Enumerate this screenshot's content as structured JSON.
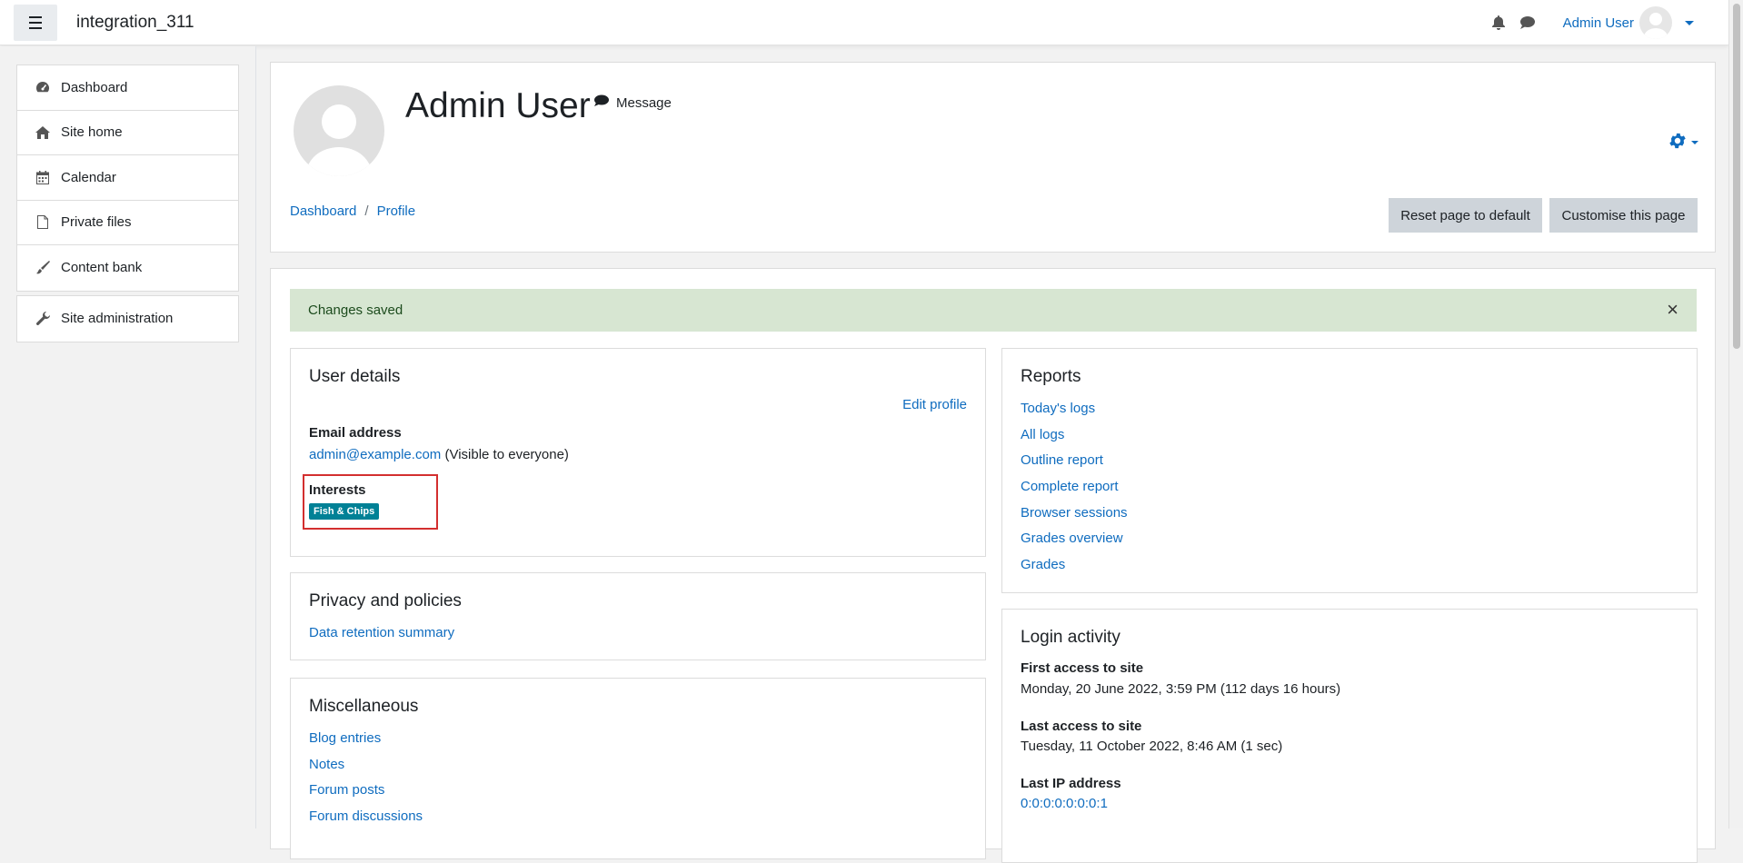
{
  "navbar": {
    "site_name": "integration_311",
    "user_name": "Admin User"
  },
  "sidebar": {
    "items": [
      {
        "label": "Dashboard",
        "icon": "dashboard-icon"
      },
      {
        "label": "Site home",
        "icon": "home-icon"
      },
      {
        "label": "Calendar",
        "icon": "calendar-icon"
      },
      {
        "label": "Private files",
        "icon": "file-icon"
      },
      {
        "label": "Content bank",
        "icon": "paintbrush-icon"
      }
    ],
    "admin_item": {
      "label": "Site administration",
      "icon": "wrench-icon"
    }
  },
  "header": {
    "name": "Admin User",
    "message_label": "Message",
    "breadcrumb": [
      "Dashboard",
      "Profile"
    ],
    "reset_label": "Reset page to default",
    "customise_label": "Customise this page"
  },
  "alert": {
    "text": "Changes saved",
    "close": "×"
  },
  "user_details": {
    "title": "User details",
    "edit_profile": "Edit profile",
    "email_label": "Email address",
    "email_value": "admin@example.com",
    "email_visibility": "(Visible to everyone)",
    "interests_label": "Interests",
    "interest_tag": "Fish & Chips"
  },
  "privacy": {
    "title": "Privacy and policies",
    "links": [
      "Data retention summary"
    ]
  },
  "misc": {
    "title": "Miscellaneous",
    "links": [
      "Blog entries",
      "Notes",
      "Forum posts",
      "Forum discussions"
    ]
  },
  "reports": {
    "title": "Reports",
    "links": [
      "Today's logs",
      "All logs",
      "Outline report",
      "Complete report",
      "Browser sessions",
      "Grades overview",
      "Grades"
    ]
  },
  "login": {
    "title": "Login activity",
    "first_label": "First access to site",
    "first_value": "Monday, 20 June 2022, 3:59 PM  (112 days 16 hours)",
    "last_label": "Last access to site",
    "last_value": "Tuesday, 11 October 2022, 8:46 AM  (1 sec)",
    "ip_label": "Last IP address",
    "ip_value": "0:0:0:0:0:0:0:1"
  },
  "colors": {
    "link": "#0f6cbf",
    "alert_bg": "#d7e6d2",
    "badge": "#008196",
    "highlight": "#d32f2f"
  }
}
